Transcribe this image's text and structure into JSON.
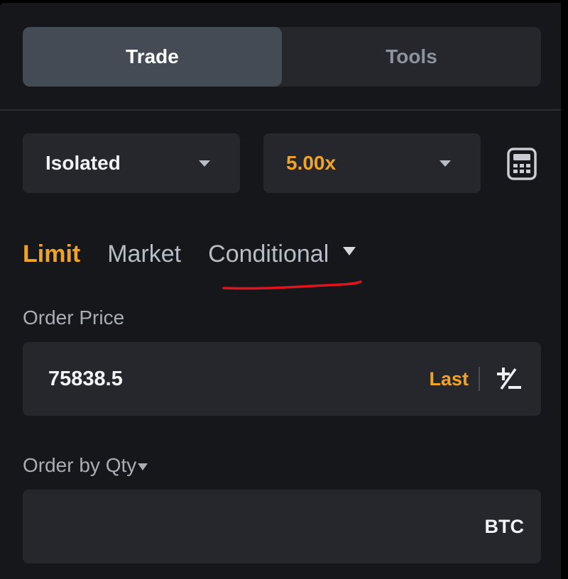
{
  "tabs": [
    {
      "label": "Trade",
      "active": true
    },
    {
      "label": "Tools",
      "active": false
    }
  ],
  "margin_mode": {
    "label": "Isolated"
  },
  "leverage": {
    "label": "5.00x"
  },
  "calculator_icon": "calculator-icon",
  "order_types": [
    {
      "label": "Limit",
      "active": true
    },
    {
      "label": "Market",
      "active": false
    },
    {
      "label": "Conditional",
      "active": false
    }
  ],
  "order_price": {
    "label": "Order Price",
    "value": "75838.5",
    "last_label": "Last",
    "adjust_icon": "plus-minus-icon"
  },
  "order_qty": {
    "label": "Order by Qty",
    "value": "",
    "unit": "BTC"
  },
  "colors": {
    "accent": "#f0a324",
    "panel_bg": "#16171b",
    "field_bg": "#25272d",
    "annotation": "#e0141e"
  }
}
